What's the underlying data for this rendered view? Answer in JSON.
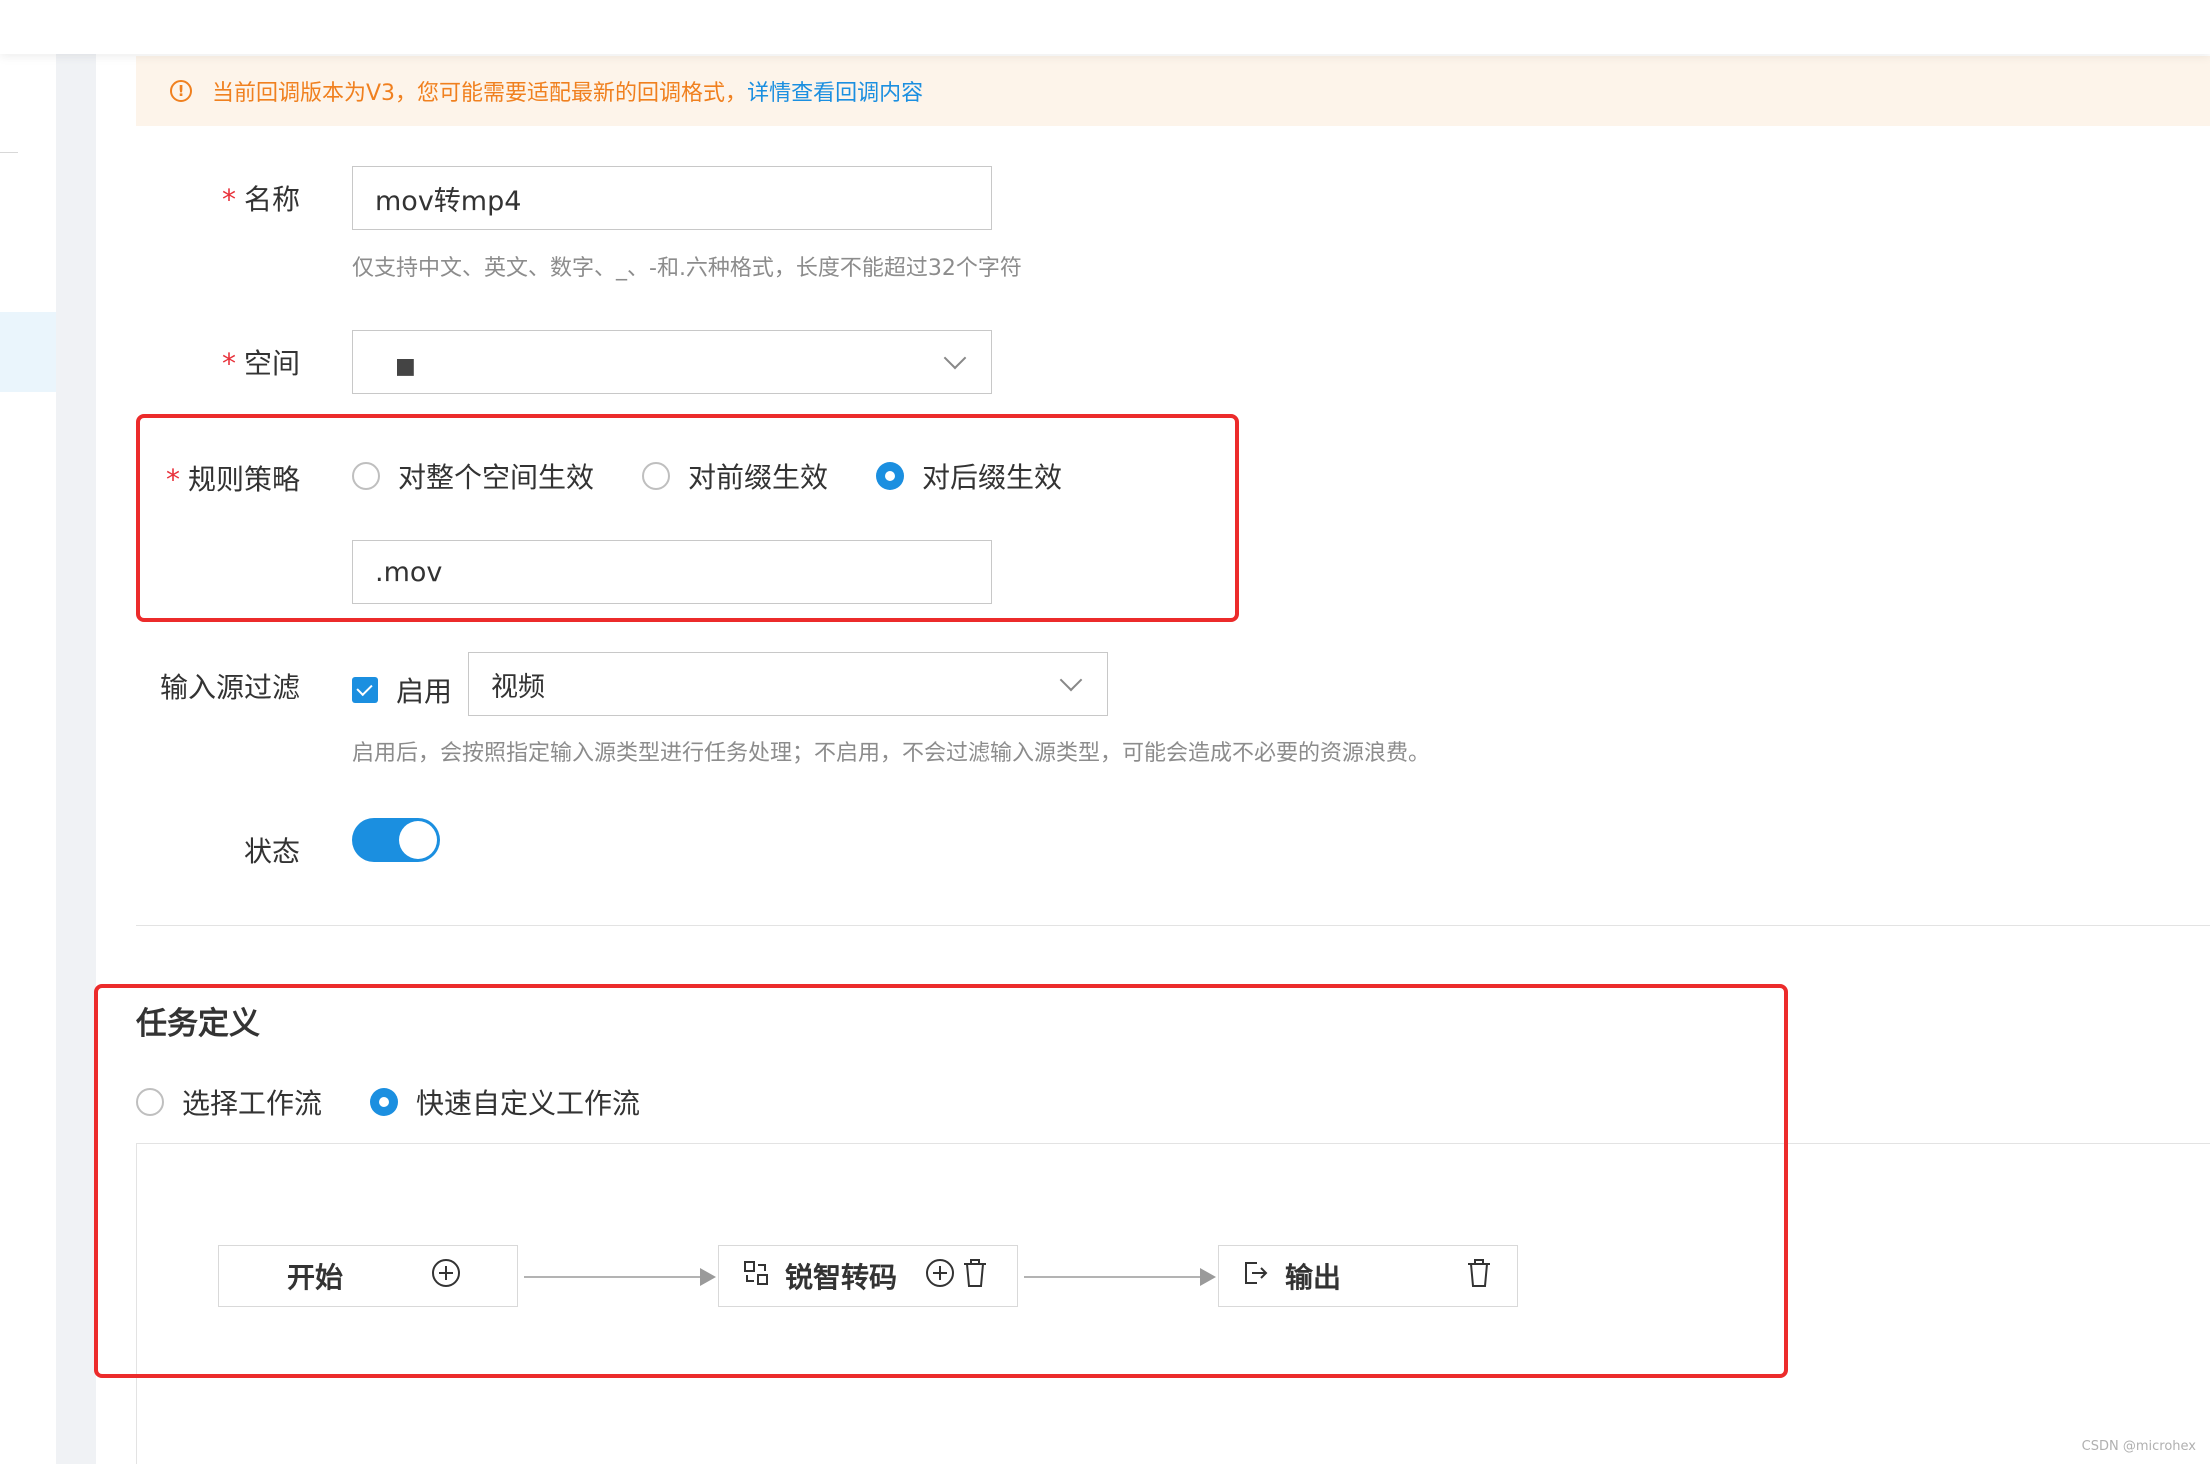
{
  "alert": {
    "message": "当前回调版本为V3，您可能需要适配最新的回调格式，",
    "link": "详情查看回调内容"
  },
  "form": {
    "name": {
      "required_mark": "*",
      "label": "名称",
      "value": "mov转mp4",
      "hint": "仅支持中文、英文、数字、_、-和.六种格式，长度不能超过32个字符"
    },
    "space": {
      "required_mark": "*",
      "label": "空间",
      "value": "■"
    },
    "rule": {
      "required_mark": "*",
      "label": "规则策略",
      "options": [
        "对整个空间生效",
        "对前缀生效",
        "对后缀生效"
      ],
      "selected_index": 2,
      "suffix_value": ".mov"
    },
    "input_filter": {
      "label": "输入源过滤",
      "checkbox_label": "启用",
      "checked": true,
      "select_value": "视频",
      "hint": "启用后，会按照指定输入源类型进行任务处理；不启用，不会过滤输入源类型，可能会造成不必要的资源浪费。"
    },
    "status": {
      "label": "状态",
      "on": true
    }
  },
  "task": {
    "title": "任务定义",
    "options": [
      "选择工作流",
      "快速自定义工作流"
    ],
    "selected_index": 1,
    "flow": {
      "start": "开始",
      "transcode": "锐智转码",
      "output": "输出"
    }
  },
  "watermark": "CSDN @microhex",
  "colors": {
    "accent": "#1b8fe0",
    "warning": "#f0801f",
    "annotation": "#ec2b2b"
  }
}
